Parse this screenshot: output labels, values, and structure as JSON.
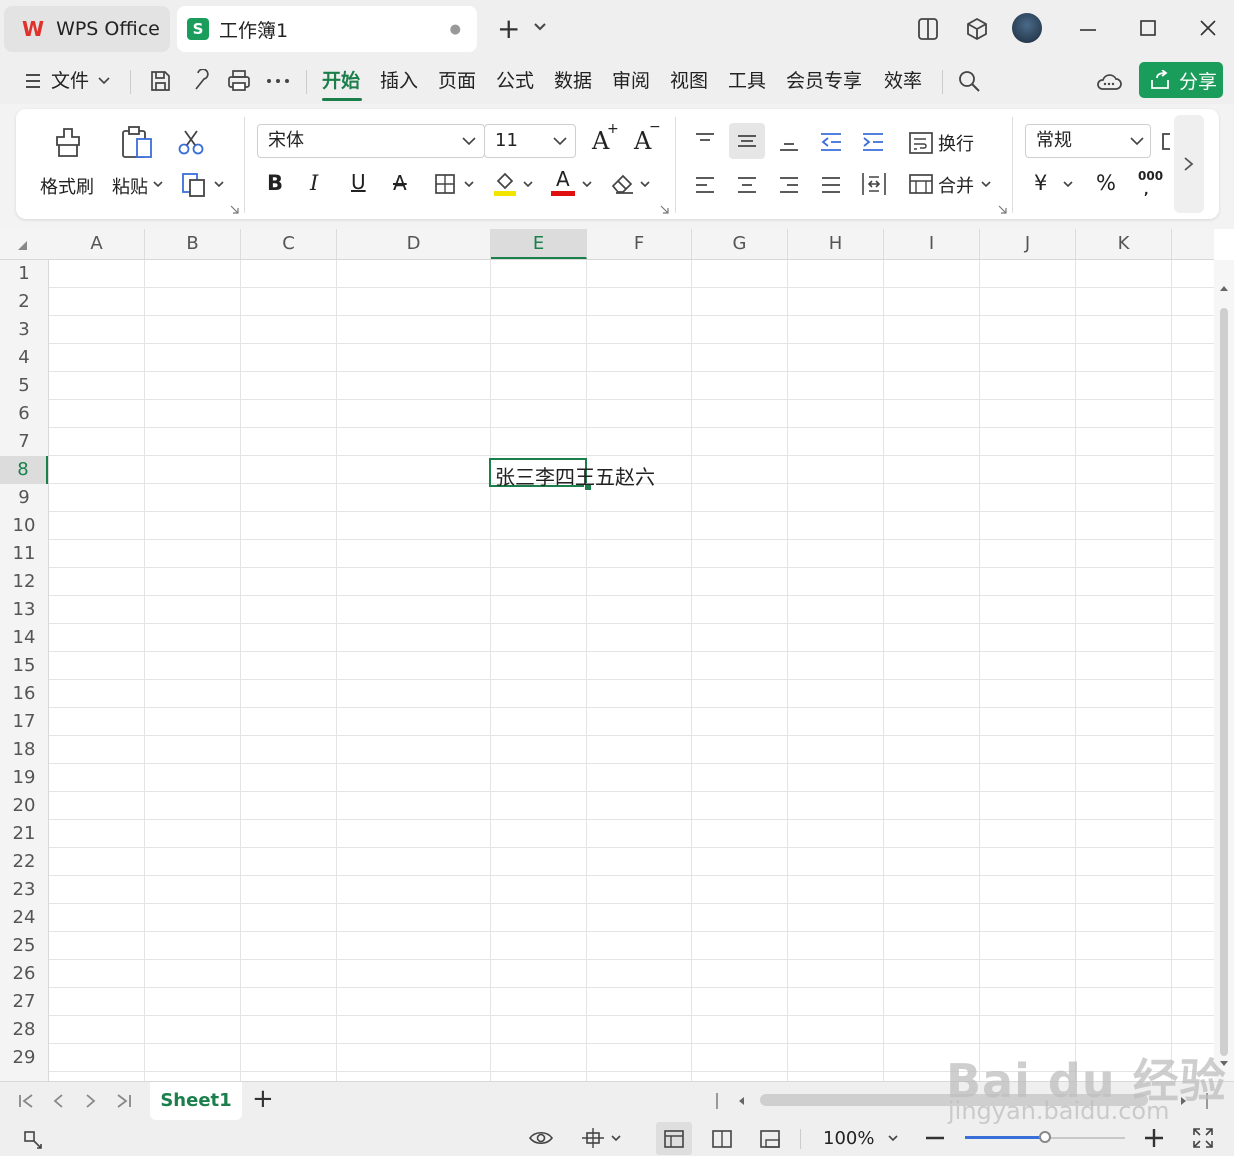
{
  "window": {
    "home_tab": "WPS Office",
    "doc_tab": "工作簿1",
    "doc_badge": "S",
    "new_tab": "+",
    "dirty_dot": "●"
  },
  "menu": {
    "file": "文件",
    "tabs": [
      "开始",
      "插入",
      "页面",
      "公式",
      "数据",
      "审阅",
      "视图",
      "工具",
      "会员专享",
      "效率"
    ],
    "active_tab": "开始",
    "share": "分享"
  },
  "ribbon": {
    "format_painter": "格式刷",
    "paste": "粘贴",
    "font_name": "宋体",
    "font_size": "11",
    "bold": "B",
    "italic": "I",
    "underline": "U",
    "strike": "A",
    "font_color_letter": "A",
    "grow_font": "A",
    "shrink_font": "A",
    "wrap": "换行",
    "merge": "合并",
    "number_format": "常规",
    "currency": "¥",
    "percent": "%",
    "thousands": "000",
    "colors": {
      "accent": "#1a7f4b",
      "highlight": "#f2e600",
      "font_color": "#e01010",
      "share_bg": "#1a9c5a"
    }
  },
  "sheet": {
    "columns": [
      "A",
      "B",
      "C",
      "D",
      "E",
      "F",
      "G",
      "H",
      "I",
      "J",
      "K"
    ],
    "selected_column": "E",
    "rows": [
      "1",
      "2",
      "3",
      "4",
      "5",
      "6",
      "7",
      "8",
      "9",
      "10",
      "11",
      "12",
      "13",
      "14",
      "15",
      "16",
      "17",
      "18",
      "19",
      "20",
      "21",
      "22",
      "23",
      "24",
      "25",
      "26",
      "27",
      "28",
      "29"
    ],
    "selected_row": "8",
    "cell_E8": "张三李四王五赵六"
  },
  "sheets": {
    "tabs": [
      "Sheet1"
    ],
    "add": "+"
  },
  "status": {
    "zoom": "100%",
    "zoom_level": 0.5
  },
  "watermark": {
    "brand": "Bai du 经验",
    "url": "jingyan.baidu.com"
  }
}
